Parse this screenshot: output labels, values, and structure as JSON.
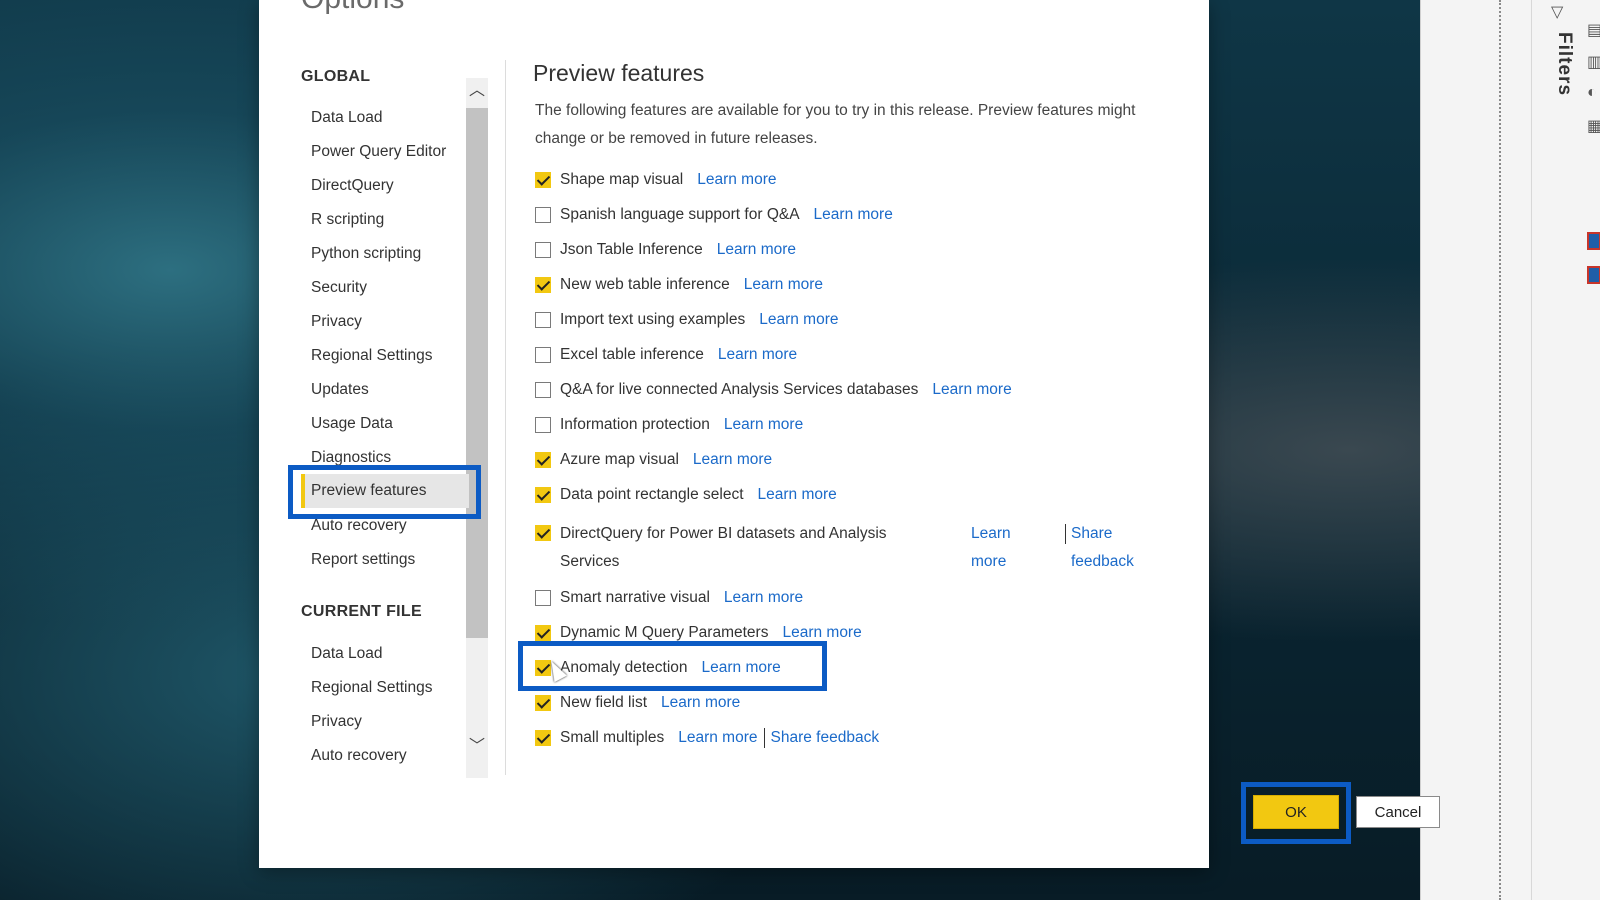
{
  "dialog": {
    "title": "Options",
    "ok_label": "OK",
    "cancel_label": "Cancel"
  },
  "sidebar": {
    "global_heading": "GLOBAL",
    "global_items": [
      {
        "label": "Data Load"
      },
      {
        "label": "Power Query Editor"
      },
      {
        "label": "DirectQuery"
      },
      {
        "label": "R scripting"
      },
      {
        "label": "Python scripting"
      },
      {
        "label": "Security"
      },
      {
        "label": "Privacy"
      },
      {
        "label": "Regional Settings"
      },
      {
        "label": "Updates"
      },
      {
        "label": "Usage Data"
      },
      {
        "label": "Diagnostics"
      },
      {
        "label": "Preview features",
        "selected": true
      },
      {
        "label": "Auto recovery"
      },
      {
        "label": "Report settings"
      }
    ],
    "current_heading": "CURRENT FILE",
    "current_items": [
      {
        "label": "Data Load"
      },
      {
        "label": "Regional Settings"
      },
      {
        "label": "Privacy"
      },
      {
        "label": "Auto recovery"
      }
    ]
  },
  "main": {
    "heading": "Preview features",
    "description": "The following features are available for you to try in this release. Preview features might change or be removed in future releases.",
    "learn_more": "Learn more",
    "share_feedback": "Share feedback",
    "features": [
      {
        "label": "Shape map visual",
        "checked": true
      },
      {
        "label": "Spanish language support for Q&A",
        "checked": false
      },
      {
        "label": "Json Table Inference",
        "checked": false
      },
      {
        "label": "New web table inference",
        "checked": true
      },
      {
        "label": "Import text using examples",
        "checked": false
      },
      {
        "label": "Excel table inference",
        "checked": false
      },
      {
        "label": "Q&A for live connected Analysis Services databases",
        "checked": false
      },
      {
        "label": "Information protection",
        "checked": false
      },
      {
        "label": "Azure map visual",
        "checked": true
      },
      {
        "label": "Data point rectangle select",
        "checked": true
      },
      {
        "label": "DirectQuery for Power BI datasets and Analysis Services",
        "checked": true
      },
      {
        "label": "Smart narrative visual",
        "checked": false
      },
      {
        "label": "Dynamic M Query Parameters",
        "checked": true
      },
      {
        "label": "Anomaly detection",
        "checked": true
      },
      {
        "label": "New field list",
        "checked": true
      },
      {
        "label": "Small multiples",
        "checked": true
      }
    ]
  },
  "right_panel": {
    "filters_label": "Filters"
  },
  "icons": {
    "checkbox_checked_color": "#f2c811",
    "link_color": "#1b6ac9",
    "highlight_color": "#0c5bc4"
  }
}
